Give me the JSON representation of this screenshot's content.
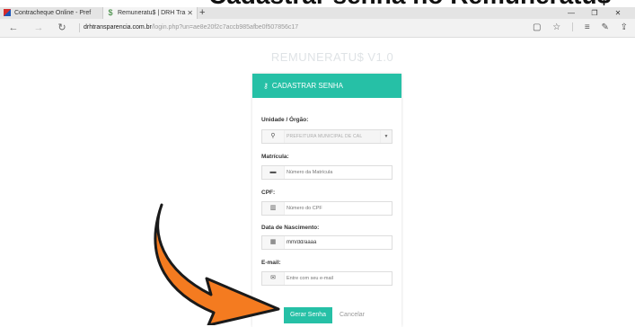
{
  "heading": "Cadastrar senha no Remuneratu$",
  "browser": {
    "tabs": [
      {
        "label": "Contracheque Online - Pref",
        "active": false
      },
      {
        "label": "Remuneratu$ | DRH Tra",
        "active": true
      }
    ],
    "url_host": "drhtransparencia.com.br",
    "url_path": "/login.php?un=ae8e20f2c7accb985afbe0f507856c17"
  },
  "app": {
    "title": "REMUNERATU$ V1.0",
    "card_title": "CADASTRAR SENHA",
    "fields": {
      "unidade": {
        "label": "Unidade / Órgão:",
        "value": "PREFEITURA MUNICIPAL DE CAL"
      },
      "matricula": {
        "label": "Matrícula:",
        "placeholder": "Número da Matrícula"
      },
      "cpf": {
        "label": "CPF:",
        "placeholder": "Número do CPF"
      },
      "nascimento": {
        "label": "Data de Nascimento:",
        "value": "mm/dd/aaaa"
      },
      "email": {
        "label": "E-mail:",
        "placeholder": "Entre com seu e-mail"
      }
    },
    "submit_label": "Gerar Senha",
    "cancel_label": "Cancelar"
  },
  "colors": {
    "accent": "#26c0a6",
    "arrow": "#f47b20"
  },
  "icons": [
    "map-marker-icon",
    "id-card-icon",
    "barcode-icon",
    "calendar-icon",
    "envelope-icon",
    "key-icon"
  ]
}
